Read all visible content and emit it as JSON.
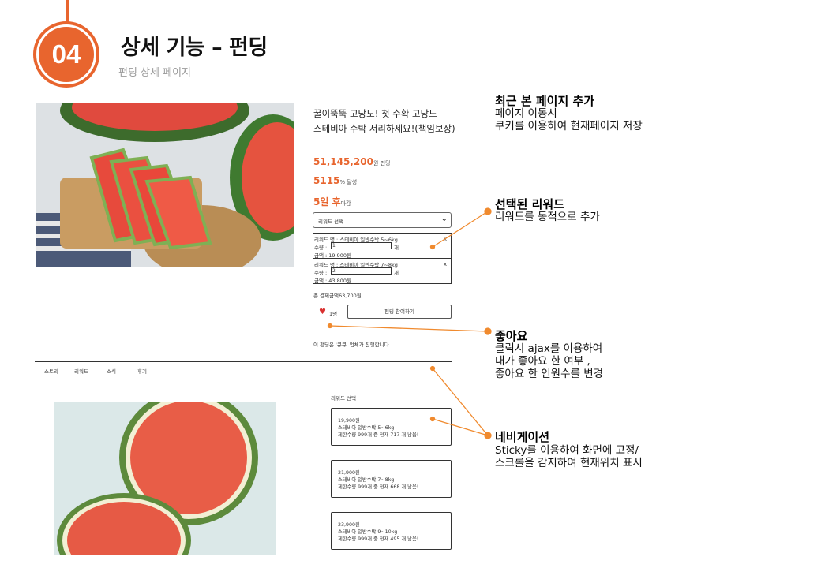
{
  "header": {
    "number": "04",
    "title": "상세 기능 – 펀딩",
    "subtitle": "펀딩 상세 페이지"
  },
  "product": {
    "title_line1": "꿀이뚝뚝 고당도! 첫 수확 고당도",
    "title_line2": "스테비아 수박 서리하세요!(책임보상)",
    "amount": "51,145,200",
    "amount_unit": "원 펀딩",
    "rate": "5115",
    "rate_unit": "% 달성",
    "days": "5일 후",
    "days_unit": "마감",
    "reward_select_placeholder": "리워드 선택",
    "selected_rewards": [
      {
        "name": "리워드 명 : 스테비아 일반수박 5~6kg",
        "qty_label": "수량 :",
        "qty": "1",
        "unit": "개",
        "price": "금액 : 19,900원",
        "remove": "x"
      },
      {
        "name": "리워드 명 : 스테비아 일반수박 7~8kg",
        "qty_label": "수량 :",
        "qty": "2",
        "unit": "개",
        "price": "금액 : 43,800원",
        "remove": "x"
      }
    ],
    "total": "총 결제금액63,700원",
    "like_count": "1명",
    "join_button": "펀딩 참여하기",
    "maker_notice": "이 펀딩은 '큐큐' 업체가 진행합니다"
  },
  "tabs": [
    "스토리",
    "리워드",
    "소식",
    "후기"
  ],
  "rewards": {
    "heading": "리워드 선택",
    "items": [
      {
        "price": "19,900원",
        "name": "스테비아 일반수박 5~6kg",
        "stock": "제한수량 999개 중 현재 717 개 남음!"
      },
      {
        "price": "21,900원",
        "name": "스테비아 일반수박 7~8kg",
        "stock": "제한수량 999개 중 현재 668 개 남음!"
      },
      {
        "price": "23,900원",
        "name": "스테비아 일반수박 9~10kg",
        "stock": "제한수량 999개 중 현재 495 개 남음!"
      }
    ]
  },
  "annotations": [
    {
      "title": "최근 본 페이지 추가",
      "lines": [
        "페이지 이동시",
        "쿠키를 이용하여 현재페이지 저장"
      ]
    },
    {
      "title": "선택된 리워드",
      "lines": [
        "리워드를 동적으로 추가"
      ]
    },
    {
      "title": "좋아요",
      "lines": [
        "클릭시 ajax를 이용하여",
        "내가 좋아요 한 여부 ,",
        "좋아요 한 인원수를 변경"
      ]
    },
    {
      "title": "네비게이션",
      "lines": [
        "Sticky를 이용하여 화면에 고정/",
        "스크롤을 감지하여 현재위치 표시"
      ]
    }
  ],
  "colors": {
    "accent": "#e8652e",
    "heart": "#d9302f"
  }
}
